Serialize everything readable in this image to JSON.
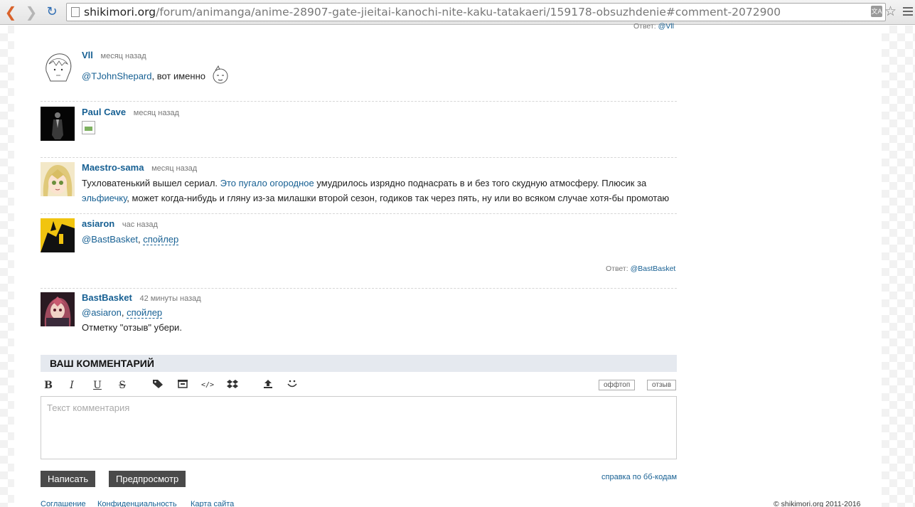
{
  "browser": {
    "url_host": "shikimori.org",
    "url_path": "/forum/animanga/anime-28907-gate-jieitai-kanochi-nite-kaku-tatakaeri/159178-obsuzhdenie#comment-2072900"
  },
  "top_reply": {
    "label": "Ответ:",
    "target": "@Vll"
  },
  "comments": [
    {
      "author": "Vll",
      "time": "месяц назад",
      "mention": "@TJohnShepard",
      "text": ", вот именно"
    },
    {
      "author": "Paul Cave",
      "time": "месяц назад"
    },
    {
      "author": "Maestro-sama",
      "time": "месяц назад",
      "text_part1": "Тухловатенький вышел сериал. ",
      "link1": "Это пугало огородное",
      "text_part2": " умудрилось изрядно поднасрать в и без того скудную атмосферу. Плюсик за",
      "link2": "эльфиечку",
      "text_part3": ", может когда-нибудь и гляну из-за милашки второй сезон, годиков так через пять, ну или во всяком случае хотя-бы промотаю"
    },
    {
      "author": "asiaron",
      "time": "час назад",
      "mention": "@BastBasket",
      "spoiler": "спойлер",
      "reply_label": "Ответ:",
      "reply_target": "@BastBasket"
    },
    {
      "author": "BastBasket",
      "time": "42 минуты назад",
      "mention": "@asiaron",
      "spoiler": "спойлер",
      "text": "Отметку \"отзыв\" убери."
    }
  ],
  "form": {
    "title": "ВАШ КОММЕНТАРИЙ",
    "bold": "B",
    "italic": "I",
    "underline": "U",
    "strike": "S",
    "offtopic": "оффтоп",
    "review": "отзыв",
    "placeholder": "Текст комментария",
    "submit": "Написать",
    "preview": "Предпросмотр",
    "bb_help": "справка по бб-кодам"
  },
  "footer": {
    "links": [
      "Соглашение",
      "Конфиденциальность",
      "Карта сайта"
    ],
    "copyright": "© shikimori.org 2011-2016"
  }
}
